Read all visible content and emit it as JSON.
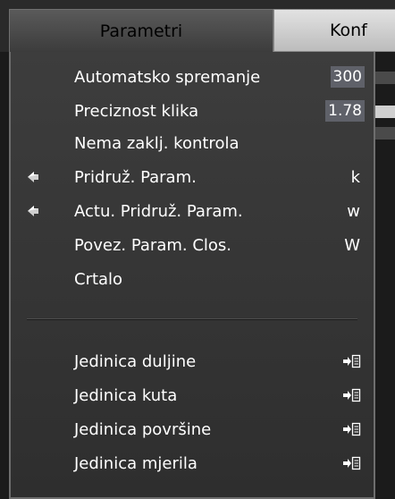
{
  "tabs": [
    {
      "label": "Parametri",
      "active": true
    },
    {
      "label": "Konf",
      "active": false
    }
  ],
  "menu": {
    "items": [
      {
        "label": "Automatsko spremanje",
        "value": "300"
      },
      {
        "label": "Preciznost klika",
        "value": "1.78"
      },
      {
        "label": "Nema zaklj. kontrola"
      },
      {
        "label": "Pridruž. Param.",
        "shortcut": "k",
        "icon": "pin-icon"
      },
      {
        "label": "Actu. Pridruž. Param.",
        "shortcut": "w",
        "icon": "pin-icon"
      },
      {
        "label": "Povez. Param. Clos.",
        "shortcut": "W"
      },
      {
        "label": "Crtalo"
      }
    ],
    "submenus": [
      {
        "label": "Jedinica duljine",
        "icon": "submenu-arrow-icon"
      },
      {
        "label": "Jedinica kuta",
        "icon": "submenu-arrow-icon"
      },
      {
        "label": "Jedinica površine",
        "icon": "submenu-arrow-icon"
      },
      {
        "label": "Jedinica mjerila",
        "icon": "submenu-arrow-icon"
      }
    ]
  },
  "colors": {
    "menu_background": "#353535",
    "value_field": "#5f6169",
    "active_tab": "#4a4a4a",
    "inactive_tab": "#cfcfcf"
  }
}
